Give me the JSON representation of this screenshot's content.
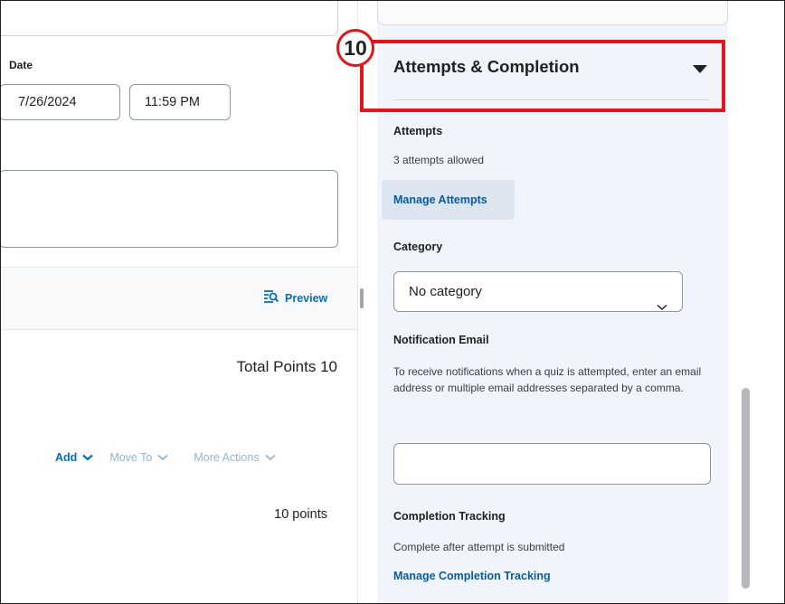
{
  "left": {
    "due_label": "Date",
    "due_date_value": "7/26/2024",
    "due_time_value": "11:59 PM",
    "preview_label": "Preview",
    "preview_icon": "preview-icon",
    "total_points": "Total Points 10",
    "actions": {
      "add": "Add",
      "move_to": "Move To",
      "more_actions": "More Actions"
    },
    "question_points": "10 points"
  },
  "right": {
    "step_number": "10",
    "section_title": "Attempts & Completion",
    "attempts_label": "Attempts",
    "attempts_allowed": "3 attempts allowed",
    "manage_attempts": "Manage Attempts",
    "category_label": "Category",
    "category_selected": "No category",
    "notification_label": "Notification Email",
    "notification_desc": "To receive notifications when a quiz is attempted, enter an email address or multiple email addresses separated by a comma.",
    "notification_value": "",
    "completion_label": "Completion Tracking",
    "completion_status": "Complete after attempt is submitted",
    "manage_completion": "Manage Completion Tracking"
  },
  "colors": {
    "link": "#006fbf",
    "highlight": "#e0161c",
    "panel_bg": "#f1f5fb",
    "button_bg": "#dde6f0"
  }
}
